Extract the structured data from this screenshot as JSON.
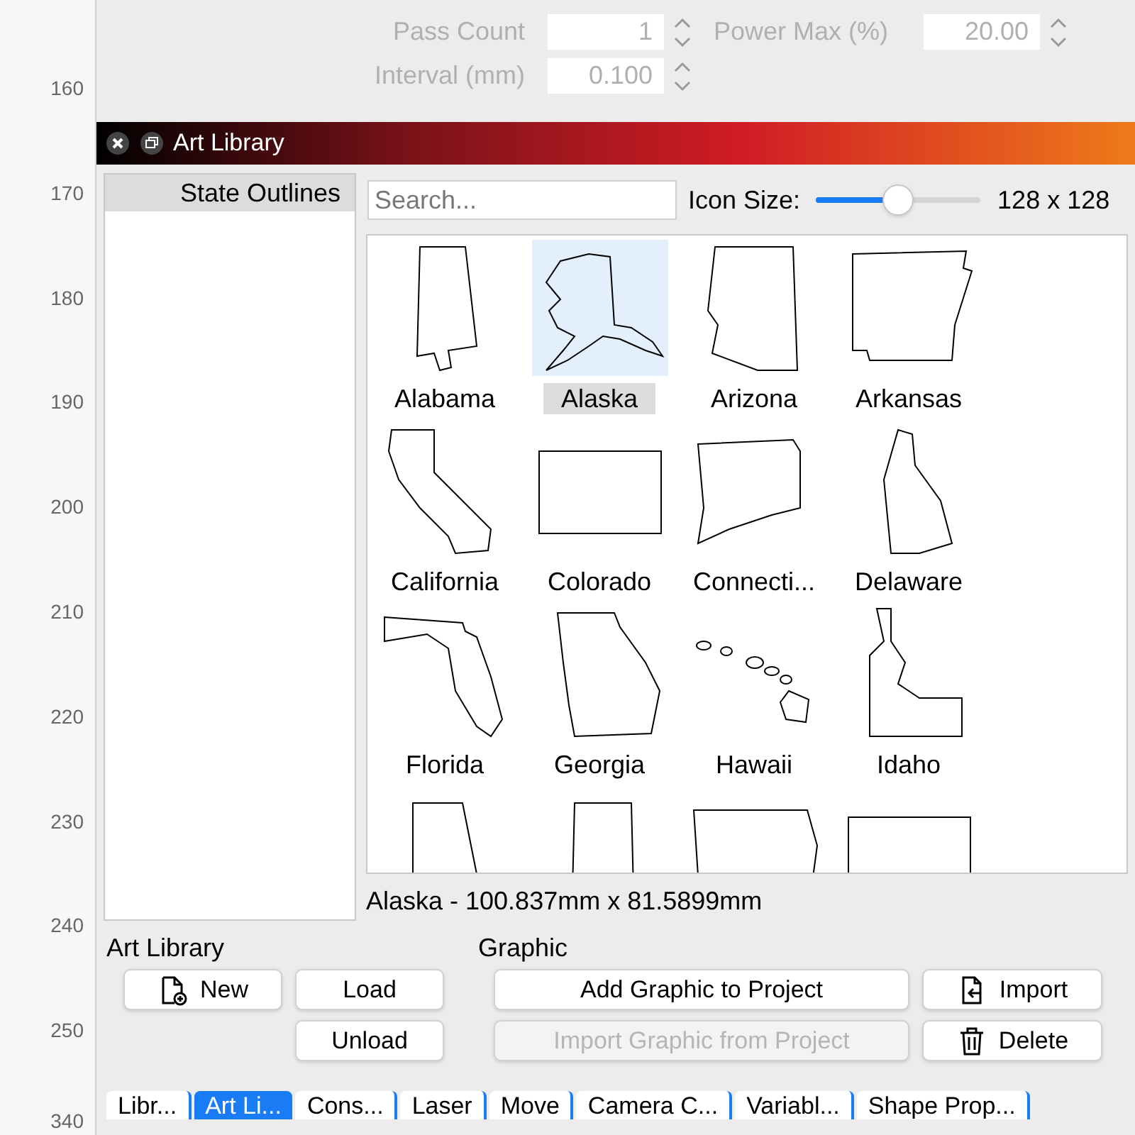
{
  "ruler": {
    "labels": [
      "160",
      "170",
      "180",
      "190",
      "200",
      "210",
      "220",
      "230",
      "240",
      "250"
    ],
    "bottom_label": "340"
  },
  "settings": {
    "rows": [
      {
        "label": "Pass Count",
        "value": "1",
        "label_2": "Power Max (%)",
        "value_2": "20.00"
      },
      {
        "label": "Interval (mm)",
        "value": "0.100"
      }
    ],
    "disabled": true
  },
  "panel": {
    "title": "Art Library"
  },
  "libraries": [
    {
      "name": "State Outlines",
      "selected": true
    }
  ],
  "search": {
    "placeholder": "Search..."
  },
  "icon_size": {
    "label": "Icon Size:",
    "level": 0.5,
    "reading": "128 x 128"
  },
  "graphics": [
    {
      "name": "Alabama",
      "selected": false
    },
    {
      "name": "Alaska",
      "selected": true
    },
    {
      "name": "Arizona",
      "selected": false
    },
    {
      "name": "Arkansas",
      "selected": false
    },
    {
      "name": "California",
      "selected": false
    },
    {
      "name": "Colorado",
      "selected": false
    },
    {
      "name": "Connecti...",
      "selected": false
    },
    {
      "name": "Delaware",
      "selected": false
    },
    {
      "name": "Florida",
      "selected": false
    },
    {
      "name": "Georgia",
      "selected": false
    },
    {
      "name": "Hawaii",
      "selected": false
    },
    {
      "name": "Idaho",
      "selected": false
    },
    {
      "selected": false
    },
    {
      "selected": false
    },
    {
      "selected": false
    },
    {
      "selected": false
    }
  ],
  "info": "Alaska - 100.837mm x 81.5899mm",
  "sections": {
    "library": "Art Library",
    "graphic": "Graphic"
  },
  "buttons": [
    {
      "label": "New",
      "kind": "new",
      "disabled": false
    },
    {
      "label": "Load",
      "kind": "plain",
      "disabled": false
    },
    {
      "label": "Add Graphic to Project",
      "kind": "plain",
      "disabled": false
    },
    {
      "label": "Import",
      "kind": "import",
      "disabled": false
    },
    {
      "label": "Unload",
      "kind": "plain",
      "disabled": false
    },
    {
      "label": "Import Graphic from Project",
      "kind": "plain",
      "disabled": true
    },
    {
      "label": "Delete",
      "kind": "delete",
      "disabled": false
    }
  ],
  "tabs": [
    {
      "label": "Libr...",
      "selected": false
    },
    {
      "label": "Art Li...",
      "selected": true
    },
    {
      "label": "Cons...",
      "selected": false
    },
    {
      "label": "Laser",
      "selected": false
    },
    {
      "label": "Move",
      "selected": false
    },
    {
      "label": "Camera C...",
      "selected": false
    },
    {
      "label": "Variabl...",
      "selected": false
    },
    {
      "label": "Shape Prop...",
      "selected": false
    }
  ]
}
